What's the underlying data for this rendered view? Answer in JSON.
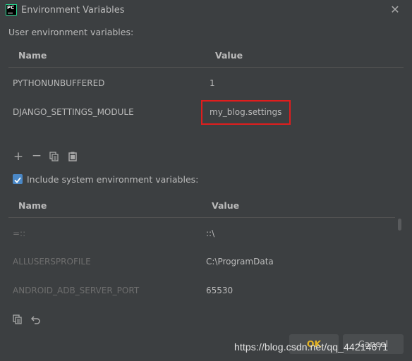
{
  "window": {
    "title": "Environment Variables",
    "app_icon_label": "PC"
  },
  "user_section": {
    "label": "User environment variables:",
    "columns": [
      "Name",
      "Value"
    ],
    "rows": [
      {
        "name": "PYTHONUNBUFFERED",
        "value": "1"
      },
      {
        "name": "DJANGO_SETTINGS_MODULE",
        "value": "my_blog.settings"
      }
    ]
  },
  "system_section": {
    "checkbox_label": "Include system environment variables:",
    "checkbox_checked": true,
    "columns": [
      "Name",
      "Value"
    ],
    "rows": [
      {
        "name": "=::",
        "value": "::\\"
      },
      {
        "name": "ALLUSERSPROFILE",
        "value": "C:\\ProgramData"
      },
      {
        "name": "ANDROID_ADB_SERVER_PORT",
        "value": "65530"
      }
    ]
  },
  "buttons": {
    "ok": "OK",
    "cancel": "Cancel"
  },
  "watermark": "https://blog.csdn.net/qq_44214671",
  "colors": {
    "highlight": "#e01d1d",
    "checkbox": "#4a88c7",
    "ok_text": "#e6b422"
  },
  "icons": {
    "user_toolbar": [
      "plus-icon",
      "minus-icon",
      "copy-icon",
      "paste-icon"
    ],
    "system_toolbar": [
      "copy-icon",
      "undo-icon"
    ]
  }
}
